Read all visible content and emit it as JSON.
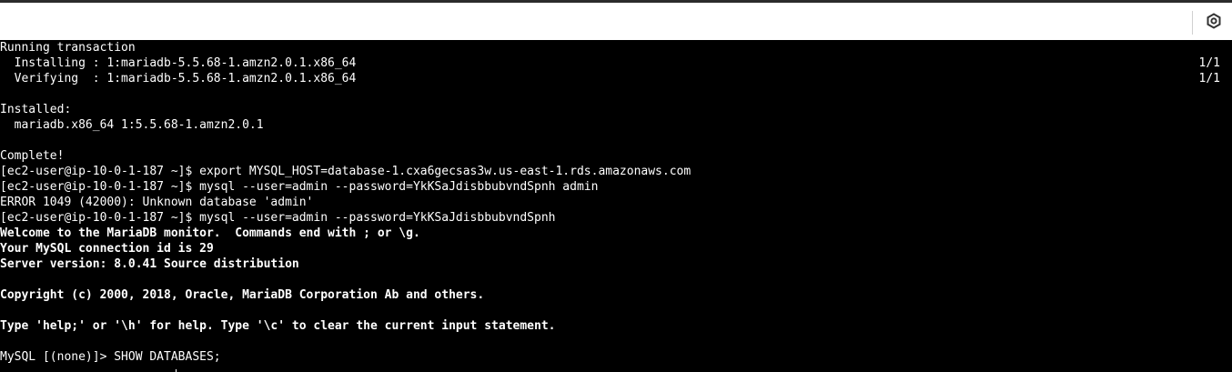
{
  "toolbar": {
    "settings_icon": "settings-icon",
    "colors": {
      "background": "#ffffff",
      "divider": "#d0d0d0",
      "icon": "#333333"
    }
  },
  "terminal": {
    "colors": {
      "background": "#000000",
      "foreground": "#ffffff"
    },
    "lines": [
      {
        "text": "Running transaction",
        "right": "",
        "bold": false
      },
      {
        "text": "  Installing : 1:mariadb-5.5.68-1.amzn2.0.1.x86_64",
        "right": "1/1",
        "bold": false
      },
      {
        "text": "  Verifying  : 1:mariadb-5.5.68-1.amzn2.0.1.x86_64",
        "right": "1/1",
        "bold": false
      },
      {
        "text": "",
        "right": "",
        "bold": false
      },
      {
        "text": "Installed:",
        "right": "",
        "bold": false
      },
      {
        "text": "  mariadb.x86_64 1:5.5.68-1.amzn2.0.1",
        "right": "",
        "bold": false
      },
      {
        "text": "",
        "right": "",
        "bold": false
      },
      {
        "text": "Complete!",
        "right": "",
        "bold": false
      },
      {
        "text": "[ec2-user@ip-10-0-1-187 ~]$ export MYSQL_HOST=database-1.cxa6gecsas3w.us-east-1.rds.amazonaws.com",
        "right": "",
        "bold": false
      },
      {
        "text": "[ec2-user@ip-10-0-1-187 ~]$ mysql --user=admin --password=YkKSaJdisbbubvndSpnh admin",
        "right": "",
        "bold": false
      },
      {
        "text": "ERROR 1049 (42000): Unknown database 'admin'",
        "right": "",
        "bold": false
      },
      {
        "text": "[ec2-user@ip-10-0-1-187 ~]$ mysql --user=admin --password=YkKSaJdisbbubvndSpnh",
        "right": "",
        "bold": false
      },
      {
        "text": "Welcome to the MariaDB monitor.  Commands end with ; or \\g.",
        "right": "",
        "bold": true
      },
      {
        "text": "Your MySQL connection id is 29",
        "right": "",
        "bold": true
      },
      {
        "text": "Server version: 8.0.41 Source distribution",
        "right": "",
        "bold": true
      },
      {
        "text": "",
        "right": "",
        "bold": false
      },
      {
        "text": "Copyright (c) 2000, 2018, Oracle, MariaDB Corporation Ab and others.",
        "right": "",
        "bold": true
      },
      {
        "text": "",
        "right": "",
        "bold": false
      },
      {
        "text": "Type 'help;' or '\\h' for help. Type '\\c' to clear the current input statement.",
        "right": "",
        "bold": true
      },
      {
        "text": "",
        "right": "",
        "bold": false
      },
      {
        "text": "MySQL [(none)]> SHOW DATABASES;",
        "right": "",
        "bold": false
      }
    ]
  }
}
